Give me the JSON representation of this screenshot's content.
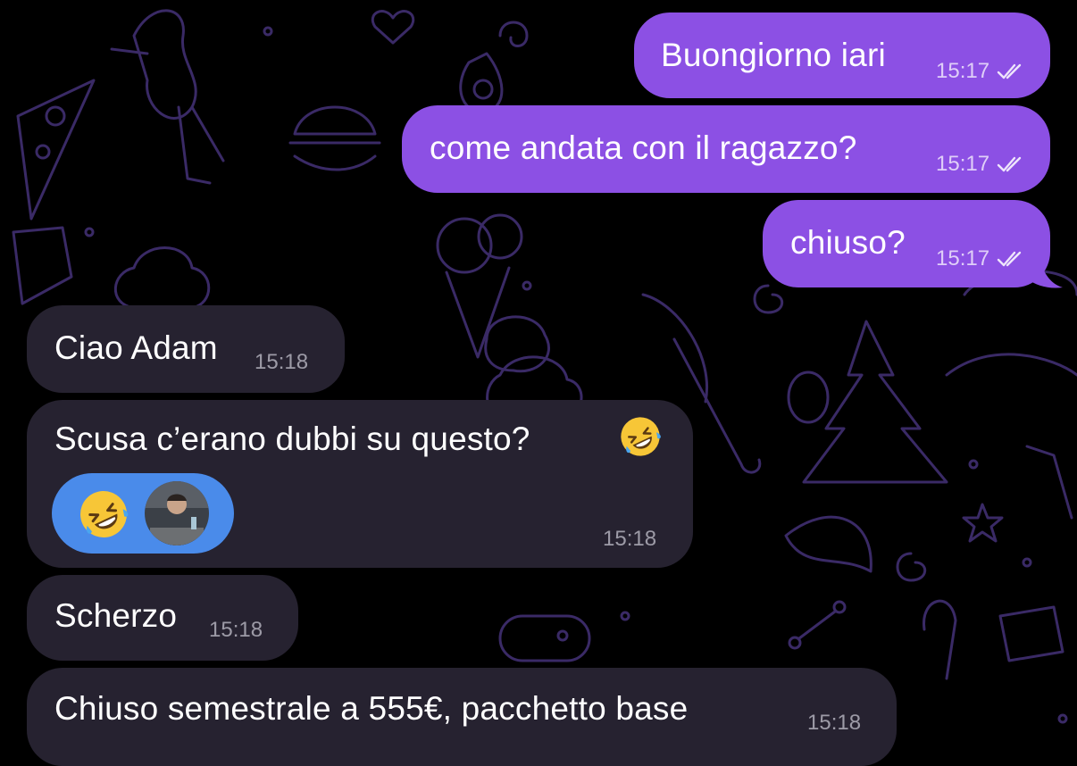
{
  "wallpaper": {
    "background_color": "#000000",
    "doodle_color": "#3a2a66"
  },
  "colors": {
    "outgoing_bubble": "#8c50e4",
    "incoming_bubble": "#262230",
    "reaction_pill": "#4a8bea"
  },
  "messages": [
    {
      "id": "m1",
      "direction": "outgoing",
      "text": "Buongiorno iari",
      "time": "15:17",
      "status": "read-checks-icon"
    },
    {
      "id": "m2",
      "direction": "outgoing",
      "text": "come andata con il ragazzo?",
      "time": "15:17",
      "status": "read-checks-icon"
    },
    {
      "id": "m3",
      "direction": "outgoing",
      "text": "chiuso?",
      "time": "15:17",
      "status": "read-checks-icon"
    },
    {
      "id": "m4",
      "direction": "incoming",
      "text": "Ciao Adam",
      "time": "15:18"
    },
    {
      "id": "m5",
      "direction": "incoming",
      "text": "Scusa c’erano dubbi su questo?",
      "trailing_emoji": "rolling-on-floor-laughing-emoji",
      "time": "15:18",
      "reactions": [
        {
          "emoji": "rolling-on-floor-laughing-emoji",
          "reactor": "user-avatar"
        }
      ]
    },
    {
      "id": "m6",
      "direction": "incoming",
      "text": "Scherzo",
      "time": "15:18"
    },
    {
      "id": "m7",
      "direction": "incoming",
      "text": "Chiuso semestrale a 555€, pacchetto base",
      "time": "15:18"
    }
  ]
}
